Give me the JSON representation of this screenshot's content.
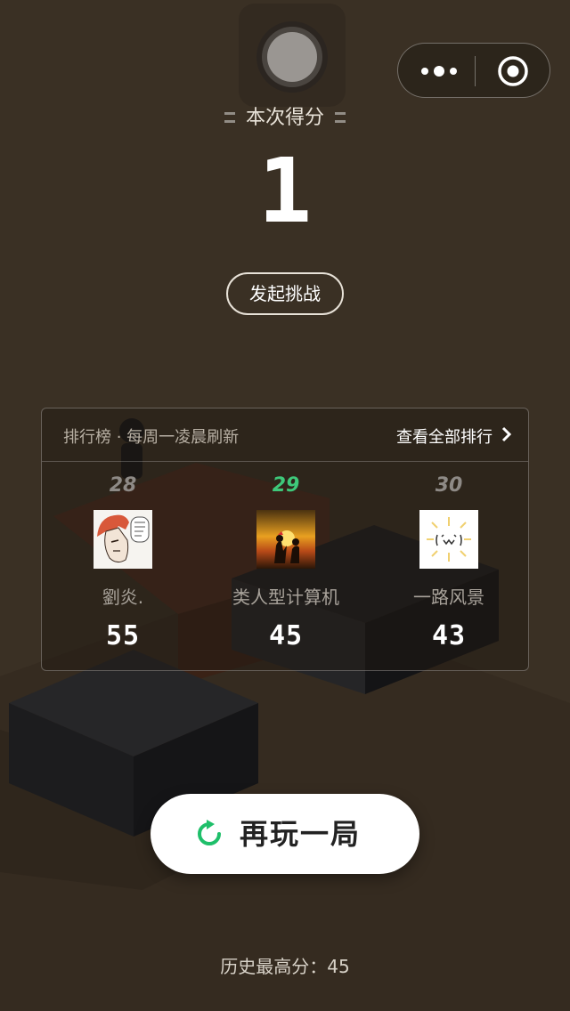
{
  "top": {
    "score_label": "本次得分",
    "score_value": "1",
    "challenge_label": "发起挑战"
  },
  "leaderboard": {
    "title": "排行榜 · 每周一凌晨刷新",
    "view_all_label": "查看全部排行",
    "entries": [
      {
        "rank": "28",
        "name": "劉炎.",
        "score": "55",
        "avatar": "manga-avatar",
        "is_me": false
      },
      {
        "rank": "29",
        "name": "类人型计算机",
        "score": "45",
        "avatar": "sunset-couple-avatar",
        "is_me": true
      },
      {
        "rank": "30",
        "name": "一路风景",
        "score": "43",
        "avatar": "emoticon-avatar",
        "is_me": false
      }
    ]
  },
  "replay": {
    "label": "再玩一局",
    "icon": "replay-icon"
  },
  "footer": {
    "best_score": "历史最高分：45"
  },
  "colors": {
    "background": "#3a3024",
    "accent_green": "#3ec87a",
    "button_white": "#ffffff"
  }
}
